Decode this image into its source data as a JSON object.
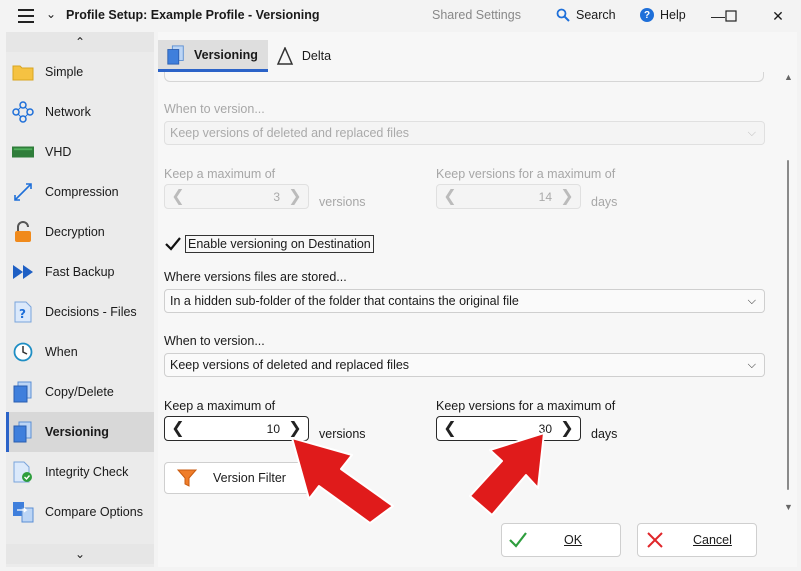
{
  "window": {
    "title": "Profile Setup: Example Profile - Versioning",
    "shared_settings": "Shared Settings",
    "search": "Search",
    "help": "Help"
  },
  "sidebar": {
    "items": [
      {
        "label": "Simple",
        "icon": "folder-icon"
      },
      {
        "label": "Network",
        "icon": "network-icon"
      },
      {
        "label": "VHD",
        "icon": "vhd-icon"
      },
      {
        "label": "Compression",
        "icon": "compression-icon"
      },
      {
        "label": "Decryption",
        "icon": "lock-icon"
      },
      {
        "label": "Fast Backup",
        "icon": "fast-forward-icon"
      },
      {
        "label": "Decisions - Files",
        "icon": "question-file-icon"
      },
      {
        "label": "When",
        "icon": "clock-icon"
      },
      {
        "label": "Copy/Delete",
        "icon": "copy-icon"
      },
      {
        "label": "Versioning",
        "icon": "versioning-icon",
        "active": true
      },
      {
        "label": "Integrity Check",
        "icon": "integrity-check-icon"
      },
      {
        "label": "Compare Options",
        "icon": "compare-icon"
      }
    ]
  },
  "tabs": [
    {
      "label": "Versioning",
      "active": true
    },
    {
      "label": "Delta",
      "active": false
    }
  ],
  "disabled_section": {
    "when_label": "When to version...",
    "when_value": "Keep versions of deleted and replaced files",
    "max_label": "Keep a maximum of",
    "max_value": "3",
    "max_unit": "versions",
    "days_label": "Keep versions for a maximum of",
    "days_value": "14",
    "days_unit": "days"
  },
  "destination": {
    "checkbox_label": "Enable versioning on Destination",
    "checked": true,
    "where_label": "Where versions files are stored...",
    "where_value": "In a hidden sub-folder of the folder that contains the original file",
    "when_label": "When to version...",
    "when_value": "Keep versions of deleted and replaced files",
    "max_label": "Keep a maximum of",
    "max_value": "10",
    "max_unit": "versions",
    "days_label": "Keep versions for a maximum of",
    "days_value": "30",
    "days_unit": "days"
  },
  "version_filter_button": "Version Filter",
  "ok_button": "OK",
  "cancel_button": "Cancel",
  "colors": {
    "accent": "#2b63c8",
    "annotation_arrow": "#e01b1b",
    "ok_check": "#2e9e3e",
    "cancel_x": "#e0262a"
  }
}
